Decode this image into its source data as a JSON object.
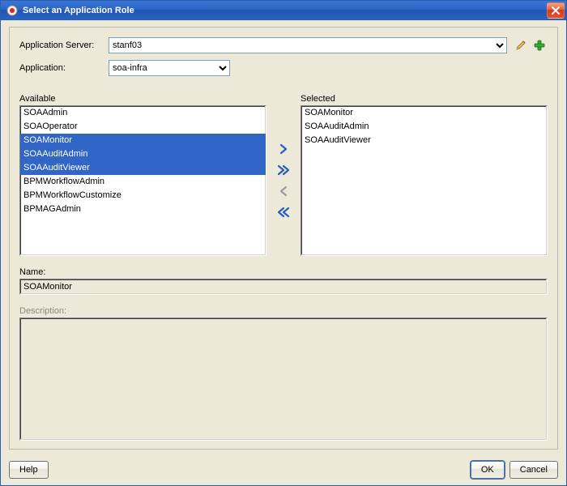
{
  "title": "Select an Application Role",
  "labels": {
    "app_server": "Application Server:",
    "application": "Application:",
    "available": "Available",
    "selected": "Selected",
    "name": "Name:",
    "description": "Description:"
  },
  "app_server": {
    "value": "stanf03"
  },
  "application": {
    "value": "soa-infra"
  },
  "available_items": [
    {
      "label": "SOAAdmin",
      "selected": false
    },
    {
      "label": "SOAOperator",
      "selected": false
    },
    {
      "label": "SOAMonitor",
      "selected": true
    },
    {
      "label": "SOAAuditAdmin",
      "selected": true
    },
    {
      "label": "SOAAuditViewer",
      "selected": true
    },
    {
      "label": "BPMWorkflowAdmin",
      "selected": false
    },
    {
      "label": "BPMWorkflowCustomize",
      "selected": false
    },
    {
      "label": "BPMAGAdmin",
      "selected": false
    }
  ],
  "selected_items": [
    {
      "label": "SOAMonitor"
    },
    {
      "label": "SOAAuditAdmin"
    },
    {
      "label": "SOAAuditViewer"
    }
  ],
  "name_value": "SOAMonitor",
  "description_value": "",
  "buttons": {
    "help": "Help",
    "ok": "OK",
    "cancel": "Cancel"
  },
  "icons": {
    "edit": "edit-icon",
    "add": "add-icon"
  }
}
